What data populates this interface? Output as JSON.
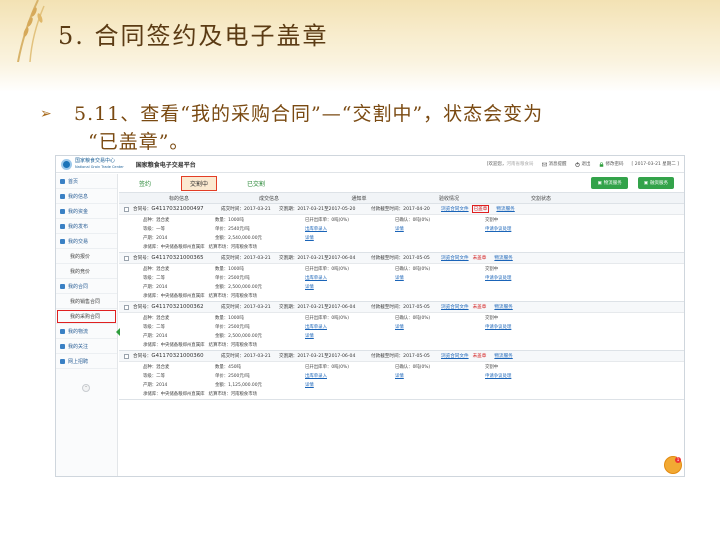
{
  "slide": {
    "title": "5. 合同签约及电子盖章",
    "bullet_line1": "5.11、查看“我的采购合同”—“交割中”，状态会变为",
    "bullet_line2": "“已盖章”。"
  },
  "app": {
    "logo_line1": "国家粮食交易中心",
    "logo_line2": "National Grain Trade Center",
    "platform_name": "国家粮食电子交易平台",
    "welcome": "[欢迎您，",
    "user_name": "河南省粮食局",
    "messages": "消息提醒",
    "exit": "退出",
    "change_password": "修改密码",
    "date": "[ 2017-03-21 星期二 ]"
  },
  "sidebar": {
    "items": [
      {
        "label": "首页"
      },
      {
        "label": "我的信息"
      },
      {
        "label": "我的资金"
      },
      {
        "label": "我的发布"
      },
      {
        "label": "我的交易"
      }
    ],
    "sub_trade": [
      {
        "label": "我的报价"
      },
      {
        "label": "我的竞价"
      }
    ],
    "contract_label": "我的合同",
    "sub_contract": [
      {
        "label": "我的销售合同"
      },
      {
        "label": "我的采购合同"
      }
    ],
    "items_after": [
      {
        "label": "我的物流"
      },
      {
        "label": "我的关注"
      },
      {
        "label": "网上招聘"
      }
    ],
    "scroll_glyph": "⌃"
  },
  "tabs": {
    "sign": "签约",
    "delivering": "交割中",
    "delivered": "已交割",
    "btn_logistics": "物流服务",
    "btn_finance": "融资服务"
  },
  "table_headers": [
    "标的信息",
    "成交信息",
    "通知单",
    "验收情况",
    "交割状态"
  ],
  "orders": [
    {
      "contract_label": "合同号：",
      "contract_no": "G41170321000497",
      "deal_time": "成交时间：2017-03-21",
      "delivery_period": "交割期：2017-03-21至2017-05-20",
      "pay_deadline": "付款截至时间：2017-04-20",
      "view_contract": "浏览合同文件",
      "status": "已盖章",
      "status_boxed": true,
      "logistics": "物流服务",
      "variety": "品种：混合麦",
      "grade": "等级：一等",
      "origin": "产期：2014",
      "qty": "数量：1000吨",
      "unit_price": "单价：2540元/吨",
      "amount": "金额：2,540,000.00元",
      "outbound": "已开出库单：0吨(0%)",
      "outbound_link": "出库单录入",
      "confirmed": "已确认：0吨(0%)",
      "detail": "详情",
      "state": "交割中",
      "dispute": "申请争议处理",
      "warehouse": "承储库：中央储备粮郑州直属库",
      "market": "结算市场：河南粮食市场"
    },
    {
      "contract_label": "合同号：",
      "contract_no": "G41170321000365",
      "deal_time": "成交时间：2017-03-21",
      "delivery_period": "交割期：2017-03-21至2017-06-04",
      "pay_deadline": "付款截至时间：2017-05-05",
      "view_contract": "浏览合同文件",
      "status": "未盖章",
      "status_boxed": false,
      "logistics": "物流服务",
      "variety": "品种：混合麦",
      "grade": "等级：二等",
      "origin": "产期：2014",
      "qty": "数量：1000吨",
      "unit_price": "单价：2500元/吨",
      "amount": "金额：2,500,000.00元",
      "outbound": "已开出库单：0吨(0%)",
      "outbound_link": "出库单录入",
      "confirmed": "已确认：0吨(0%)",
      "detail": "详情",
      "state": "交割中",
      "dispute": "申请争议处理",
      "warehouse": "承储库：中央储备粮郑州直属库",
      "market": "结算市场：河南粮食市场"
    },
    {
      "contract_label": "合同号：",
      "contract_no": "G41170321000362",
      "deal_time": "成交时间：2017-03-21",
      "delivery_period": "交割期：2017-03-21至2017-06-04",
      "pay_deadline": "付款截至时间：2017-05-05",
      "view_contract": "浏览合同文件",
      "status": "未盖章",
      "status_boxed": false,
      "logistics": "物流服务",
      "variety": "品种：混合麦",
      "grade": "等级：二等",
      "origin": "产期：2014",
      "qty": "数量：1000吨",
      "unit_price": "单价：2500元/吨",
      "amount": "金额：2,500,000.00元",
      "outbound": "已开出库单：0吨(0%)",
      "outbound_link": "出库单录入",
      "confirmed": "已确认：0吨(0%)",
      "detail": "详情",
      "state": "交割中",
      "dispute": "申请争议处理",
      "warehouse": "承储库：中央储备粮郑州直属库",
      "market": "结算市场：河南粮食市场"
    },
    {
      "contract_label": "合同号：",
      "contract_no": "G41170321000360",
      "deal_time": "成交时间：2017-03-21",
      "delivery_period": "交割期：2017-03-21至2017-06-04",
      "pay_deadline": "付款截至时间：2017-05-05",
      "view_contract": "浏览合同文件",
      "status": "未盖章",
      "status_boxed": false,
      "logistics": "物流服务",
      "variety": "品种：混合麦",
      "grade": "等级：二等",
      "origin": "产期：2014",
      "qty": "数量：450吨",
      "unit_price": "单价：2500元/吨",
      "amount": "金额：1,125,000.00元",
      "outbound": "已开出库单：0吨(0%)",
      "outbound_link": "出库单录入",
      "confirmed": "已确认：0吨(0%)",
      "detail": "详情",
      "state": "交割中",
      "dispute": "申请争议处理",
      "warehouse": "承储库：中央储备粮郑州直属库",
      "market": "结算市场：河南粮食市场"
    }
  ],
  "chat_badge": "1",
  "colors": {
    "title_brown": "#5b3b14",
    "accent_green": "#33a34a",
    "status_red": "#d42020",
    "link_blue": "#1a64b8"
  }
}
